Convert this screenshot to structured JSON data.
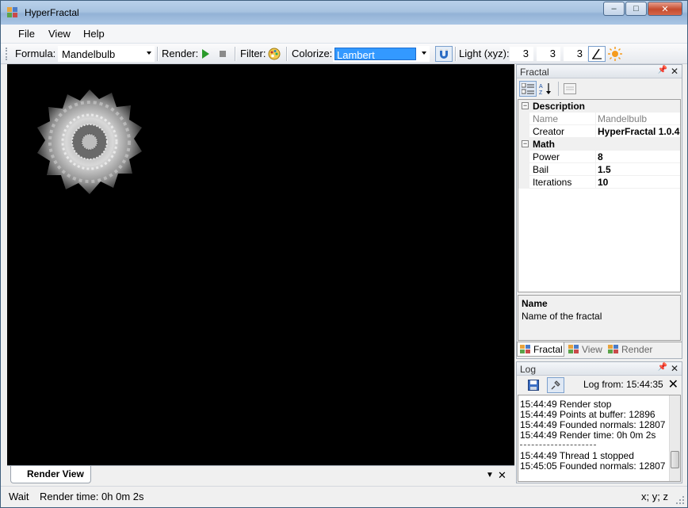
{
  "window": {
    "title": "HyperFractal",
    "minimize": "–",
    "maximize": "□",
    "close": "✕"
  },
  "menu": {
    "items": [
      "File",
      "View",
      "Help"
    ]
  },
  "toolbar": {
    "formula_label": "Formula:",
    "formula_value": "Mandelbulb",
    "render_label": "Render:",
    "filter_label": "Filter:",
    "colorize_label": "Colorize:",
    "colorize_value": "Lambert",
    "light_label": "Light (xyz):",
    "light_x": "3",
    "light_y": "3",
    "light_z": "3"
  },
  "document": {
    "tab_label": "Render View",
    "dropdown": "▼",
    "close": "✕"
  },
  "fractal_panel": {
    "title": "Fractal",
    "pin": "📌",
    "close": "✕",
    "categories": [
      {
        "label": "Description",
        "expander": "−",
        "props": [
          {
            "name": "Name",
            "value": "Mandelbulb",
            "readonly": true,
            "bold": false
          },
          {
            "name": "Creator",
            "value": "HyperFractal 1.0.4",
            "readonly": false,
            "bold": true
          }
        ]
      },
      {
        "label": "Math",
        "expander": "−",
        "props": [
          {
            "name": "Power",
            "value": "8",
            "readonly": false,
            "bold": true
          },
          {
            "name": "Bail",
            "value": "1.5",
            "readonly": false,
            "bold": true
          },
          {
            "name": "Iterations",
            "value": "10",
            "readonly": false,
            "bold": true
          }
        ]
      }
    ],
    "description": {
      "title": "Name",
      "text": "Name of the fractal"
    },
    "tabs": [
      "Fractal",
      "View",
      "Render"
    ]
  },
  "log_panel": {
    "title": "Log",
    "pin": "📌",
    "close": "✕",
    "log_from": "Log from: 15:44:35",
    "clear": "✕",
    "lines": [
      "15:44:49  Render stop",
      "15:44:49  Points at buffer: 12896",
      "15:44:49  Founded normals: 12807",
      "15:44:49  Render time: 0h 0m 2s",
      "",
      "15:44:49  Thread 1 stopped",
      "15:45:05  Founded normals: 12807"
    ]
  },
  "status": {
    "state": "Wait",
    "render_time": "Render time: 0h 0m 2s",
    "coords": "x; y; z"
  },
  "colors": {
    "render_bg": "#000000",
    "selection": "#3399ff",
    "accent": "#2a8a2a",
    "title_grad": "#a8c3e0"
  }
}
